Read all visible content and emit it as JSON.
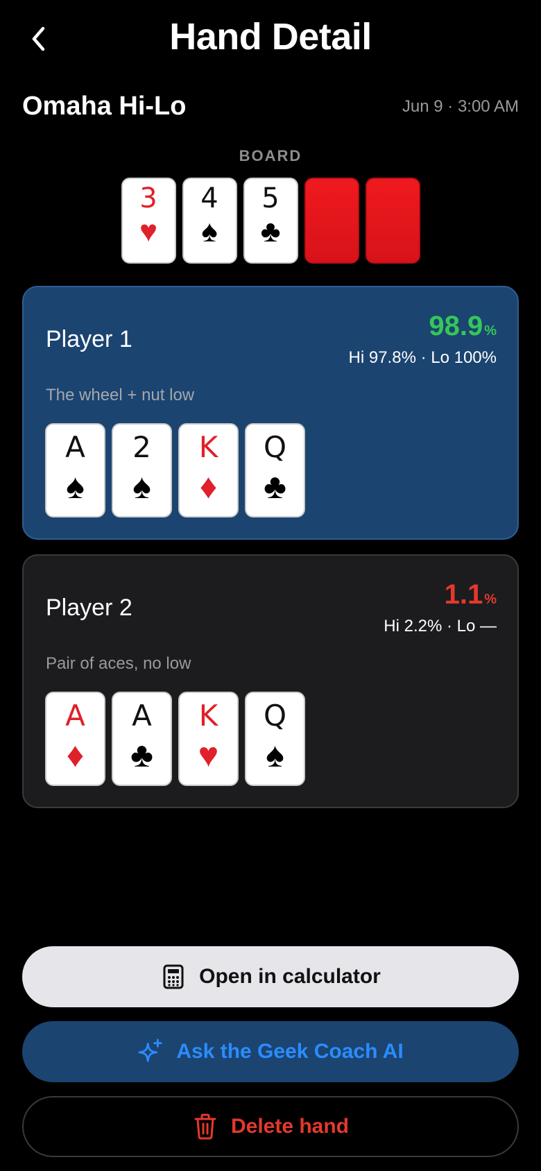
{
  "header": {
    "title": "Hand Detail",
    "back_icon": "chevron-left-icon"
  },
  "game": {
    "name": "Omaha Hi-Lo",
    "timestamp": "Jun 9 · 3:00 AM"
  },
  "board": {
    "label": "BOARD",
    "cards": [
      {
        "rank": "3",
        "suit": "♥",
        "suit_name": "hearts",
        "color": "red"
      },
      {
        "rank": "4",
        "suit": "♠",
        "suit_name": "spades",
        "color": "black"
      },
      {
        "rank": "5",
        "suit": "♣",
        "suit_name": "clubs",
        "color": "black"
      },
      {
        "rank": "",
        "suit": "",
        "suit_name": "face-down",
        "color": "back"
      },
      {
        "rank": "",
        "suit": "",
        "suit_name": "face-down",
        "color": "back"
      }
    ]
  },
  "players": [
    {
      "name": "Player 1",
      "equity_value": "98.9",
      "equity_unit": "%",
      "equity_color": "#34c759",
      "hilo": "Hi 97.8% · Lo 100%",
      "description": "The wheel + nut low",
      "cards": [
        {
          "rank": "A",
          "suit": "♠",
          "color": "black"
        },
        {
          "rank": "2",
          "suit": "♠",
          "color": "black"
        },
        {
          "rank": "K",
          "suit": "♦",
          "color": "red"
        },
        {
          "rank": "Q",
          "suit": "♣",
          "color": "black"
        }
      ]
    },
    {
      "name": "Player 2",
      "equity_value": "1.1",
      "equity_unit": "%",
      "equity_color": "#e5382d",
      "hilo": "Hi 2.2% · Lo —",
      "description": "Pair of aces, no low",
      "cards": [
        {
          "rank": "A",
          "suit": "♦",
          "color": "red"
        },
        {
          "rank": "A",
          "suit": "♣",
          "color": "black"
        },
        {
          "rank": "K",
          "suit": "♥",
          "color": "red"
        },
        {
          "rank": "Q",
          "suit": "♠",
          "color": "black"
        }
      ]
    }
  ],
  "actions": {
    "calculator_label": "Open in calculator",
    "calculator_icon": "calculator-icon",
    "coach_label": "Ask the Geek Coach AI",
    "coach_icon": "sparkles-icon",
    "delete_label": "Delete hand",
    "delete_icon": "trash-icon"
  },
  "colors": {
    "background": "#000000",
    "player1_panel": "#1b4470",
    "player2_panel": "#1c1c1e",
    "accent_blue": "#2a8cff",
    "danger_red": "#e5382d",
    "win_green": "#34c759"
  }
}
